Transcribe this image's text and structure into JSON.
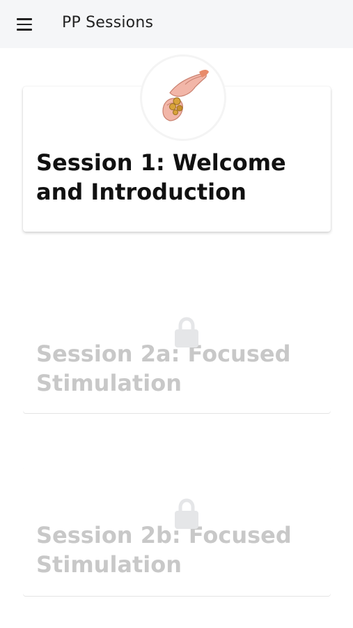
{
  "app": {
    "title": "PP Sessions",
    "menu_icon": "hamburger-menu-icon"
  },
  "sessions": [
    {
      "title": "Session 1: Welcome and Introduction",
      "locked": false,
      "image": "hands-exchanging-coins-illustration"
    },
    {
      "title": "Session 2a: Focused Stimulation",
      "locked": true,
      "icon": "lock-icon"
    },
    {
      "title": "Session 2b: Focused Stimulation",
      "locked": true,
      "icon": "lock-icon"
    }
  ],
  "colors": {
    "appbar_bg": "#f5f6f8",
    "active_text": "#111111",
    "locked_text": "#c8c8c8",
    "lock_icon": "#e5e6e8"
  }
}
